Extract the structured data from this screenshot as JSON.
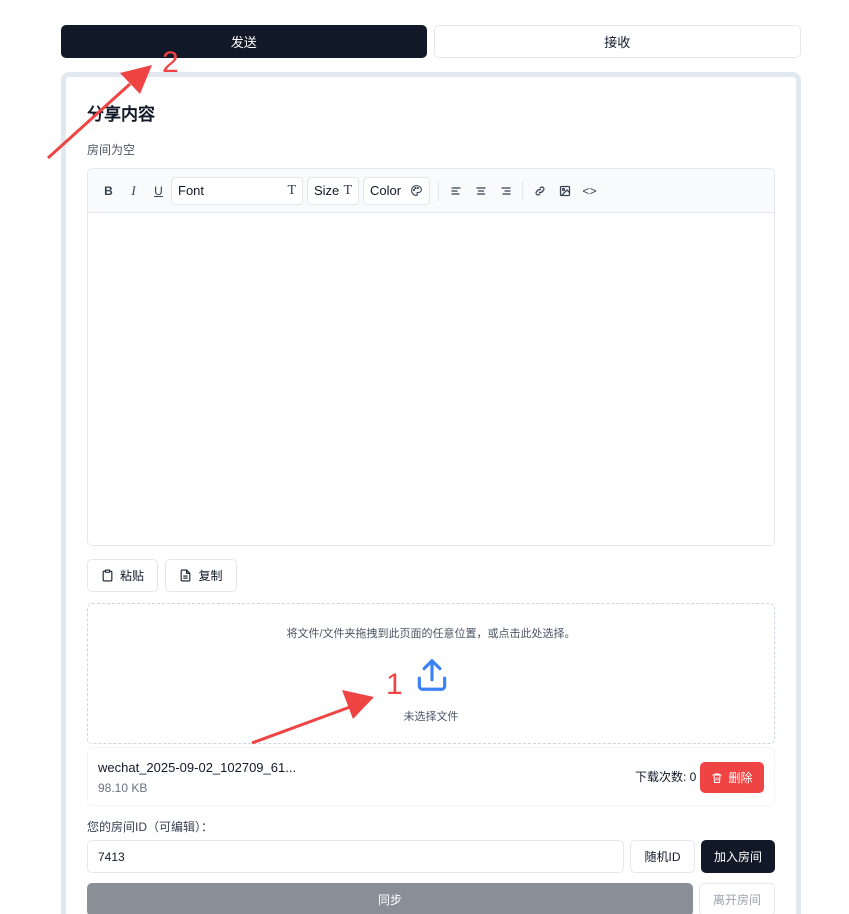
{
  "tabs": [
    {
      "label": "发送",
      "active": true
    },
    {
      "label": "接收",
      "active": false
    }
  ],
  "panel": {
    "title": "分享内容",
    "room_status": "房间为空"
  },
  "editor_toolbar": {
    "bold": "B",
    "italic": "I",
    "underline": "U",
    "font_label": "Font",
    "size_label": "Size",
    "color_label": "Color",
    "code_label": "<>"
  },
  "actions": {
    "paste_label": "粘贴",
    "copy_label": "复制"
  },
  "dropzone": {
    "hint": "将文件/文件夹拖拽到此页面的任意位置，或点击此处选择。",
    "status": "未选择文件"
  },
  "file": {
    "name": "wechat_2025-09-02_102709_61...",
    "size": "98.10 KB",
    "downloads_label": "下载次数: 0",
    "delete_label": "删除"
  },
  "room": {
    "id_label": "您的房间ID（可编辑）：",
    "id_value": "7413",
    "random_label": "随机ID",
    "join_label": "加入房间",
    "sync_label": "同步",
    "leave_label": "离开房间"
  },
  "annotations": {
    "marker_1": "1",
    "marker_2": "2",
    "color": "#ef4444"
  },
  "colors": {
    "primary_dark": "#111827",
    "danger": "#ef4444",
    "upload_icon": "#3b82f6",
    "sync_disabled": "#8a8e96"
  },
  "icons": [
    "clipboard-icon",
    "file-text-icon",
    "upload-icon",
    "trash-icon",
    "palette-icon",
    "link-icon",
    "image-icon",
    "align-left-icon",
    "align-center-icon",
    "align-right-icon",
    "type-icon"
  ]
}
